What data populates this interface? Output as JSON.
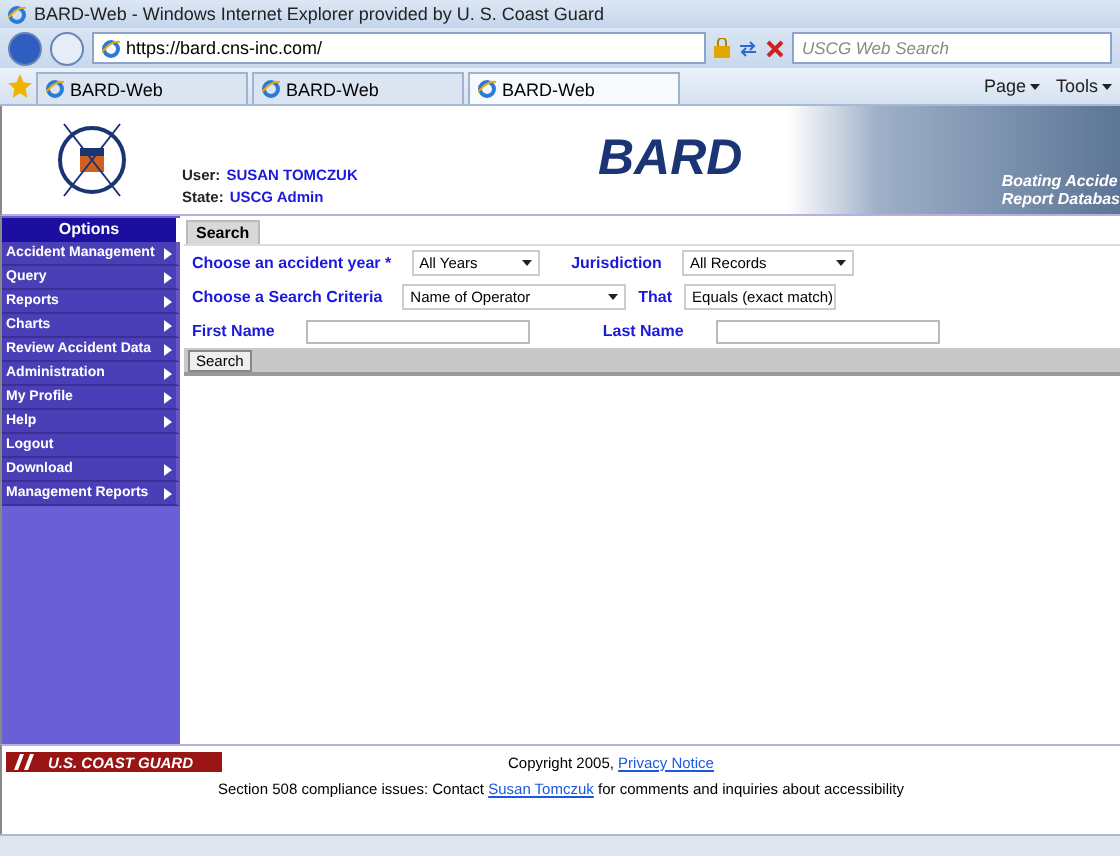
{
  "browser": {
    "title": "BARD-Web - Windows Internet Explorer provided by U. S. Coast Guard",
    "address": "https://bard.cns-inc.com/",
    "search_placeholder": "USCG Web Search",
    "tabs": [
      {
        "label": "BARD-Web",
        "selected": false
      },
      {
        "label": "BARD-Web",
        "selected": false
      },
      {
        "label": "BARD-Web",
        "selected": true
      }
    ],
    "toolbar": [
      "Page",
      "Tools"
    ]
  },
  "header": {
    "user_label": "User:",
    "user": "SUSAN TOMCZUK",
    "state_label": "State:",
    "state": "USCG Admin",
    "logo": "BARD",
    "tagline": [
      "Boating Accide",
      "Report Databas"
    ]
  },
  "sidebar": {
    "heading": "Options",
    "items": [
      {
        "label": "Accident Management",
        "submenu": true
      },
      {
        "label": "Query",
        "submenu": true
      },
      {
        "label": "Reports",
        "submenu": true
      },
      {
        "label": "Charts",
        "submenu": true
      },
      {
        "label": "Review Accident Data",
        "submenu": true
      },
      {
        "label": "Administration",
        "submenu": true
      },
      {
        "label": "My Profile",
        "submenu": true
      },
      {
        "label": "Help",
        "submenu": true
      },
      {
        "label": "Logout",
        "submenu": false
      },
      {
        "label": "Download",
        "submenu": true
      },
      {
        "label": "Management Reports",
        "submenu": true
      }
    ]
  },
  "search": {
    "tab": "Search",
    "year_label": "Choose an accident year *",
    "year": "All Years",
    "jurisdiction_label": "Jurisdiction",
    "jurisdiction": "All Records",
    "criteria_label": "Choose a Search Criteria",
    "criteria": "Name of Operator",
    "that_label": "That",
    "that": "Equals (exact match)",
    "first_name_label": "First Name",
    "last_name_label": "Last Name",
    "button": "Search"
  },
  "footer": {
    "brand": "U.S. COAST GUARD",
    "copyright": "Copyright 2005,",
    "privacy_link": "Privacy Notice",
    "section_text": "Section 508 compliance issues: Contact",
    "contact_link": "Susan Tomczuk",
    "section_tail": "for comments and inquiries about accessibility"
  }
}
